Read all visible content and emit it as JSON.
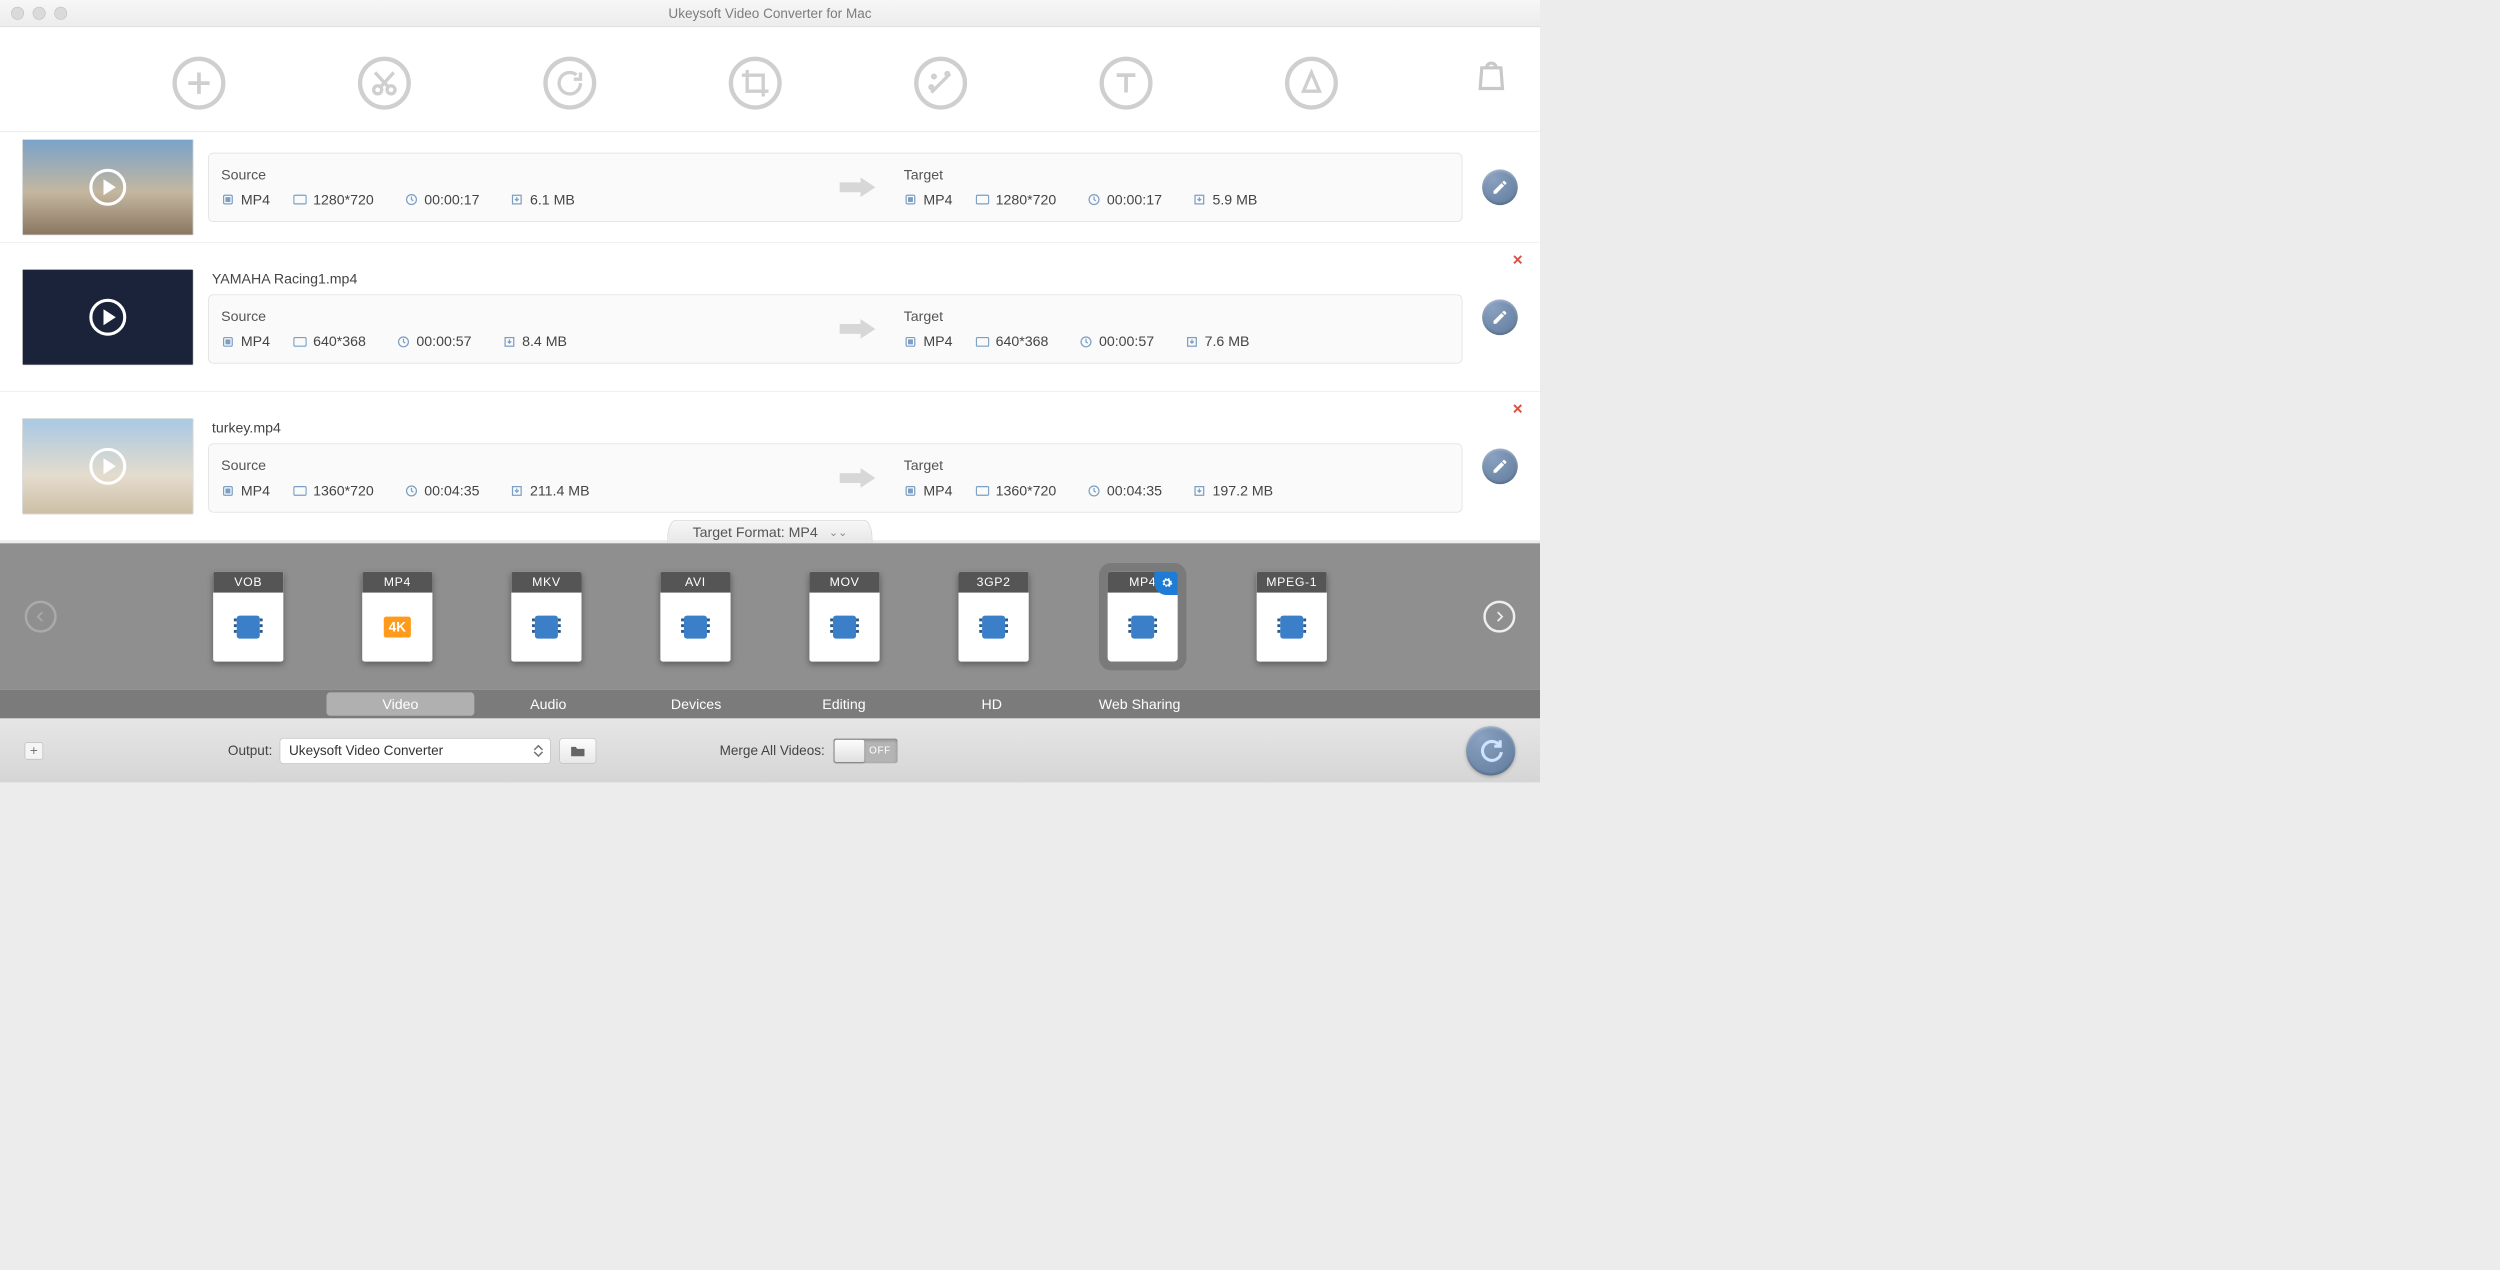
{
  "window": {
    "title": "Ukeysoft Video Converter for Mac"
  },
  "toolbar": {
    "icons": [
      "add",
      "cut",
      "rotate",
      "crop",
      "effects",
      "text",
      "annotate",
      "bag"
    ]
  },
  "rows": [
    {
      "filename": "",
      "show_filename": false,
      "close": false,
      "thumb_class": "th-landscape",
      "source": {
        "label": "Source",
        "format": "MP4",
        "resolution": "1280*720",
        "duration": "00:00:17",
        "size": "6.1 MB"
      },
      "target": {
        "label": "Target",
        "format": "MP4",
        "resolution": "1280*720",
        "duration": "00:00:17",
        "size": "5.9 MB"
      }
    },
    {
      "filename": "YAMAHA Racing1.mp4",
      "show_filename": true,
      "close": true,
      "thumb_class": "th-dark",
      "source": {
        "label": "Source",
        "format": "MP4",
        "resolution": "640*368",
        "duration": "00:00:57",
        "size": "8.4 MB"
      },
      "target": {
        "label": "Target",
        "format": "MP4",
        "resolution": "640*368",
        "duration": "00:00:57",
        "size": "7.6 MB"
      }
    },
    {
      "filename": "turkey.mp4",
      "show_filename": true,
      "close": true,
      "thumb_class": "th-sand",
      "source": {
        "label": "Source",
        "format": "MP4",
        "resolution": "1360*720",
        "duration": "00:04:35",
        "size": "211.4 MB"
      },
      "target": {
        "label": "Target",
        "format": "MP4",
        "resolution": "1360*720",
        "duration": "00:04:35",
        "size": "197.2 MB"
      }
    }
  ],
  "target_format": {
    "label": "Target Format: MP4"
  },
  "formats": [
    {
      "name": "VOB",
      "selected": false
    },
    {
      "name": "MP4",
      "sub": "4K",
      "selected": false
    },
    {
      "name": "MKV",
      "selected": false
    },
    {
      "name": "AVI",
      "selected": false
    },
    {
      "name": "MOV",
      "selected": false
    },
    {
      "name": "3GP2",
      "selected": false
    },
    {
      "name": "MP4",
      "selected": true
    },
    {
      "name": "MPEG-1",
      "selected": false
    }
  ],
  "categories": [
    {
      "label": "Video",
      "active": true
    },
    {
      "label": "Audio",
      "active": false
    },
    {
      "label": "Devices",
      "active": false
    },
    {
      "label": "Editing",
      "active": false
    },
    {
      "label": "HD",
      "active": false
    },
    {
      "label": "Web Sharing",
      "active": false
    }
  ],
  "bottom": {
    "output_label": "Output:",
    "output_value": "Ukeysoft Video Converter",
    "merge_label": "Merge All Videos:",
    "merge_state": "OFF"
  }
}
